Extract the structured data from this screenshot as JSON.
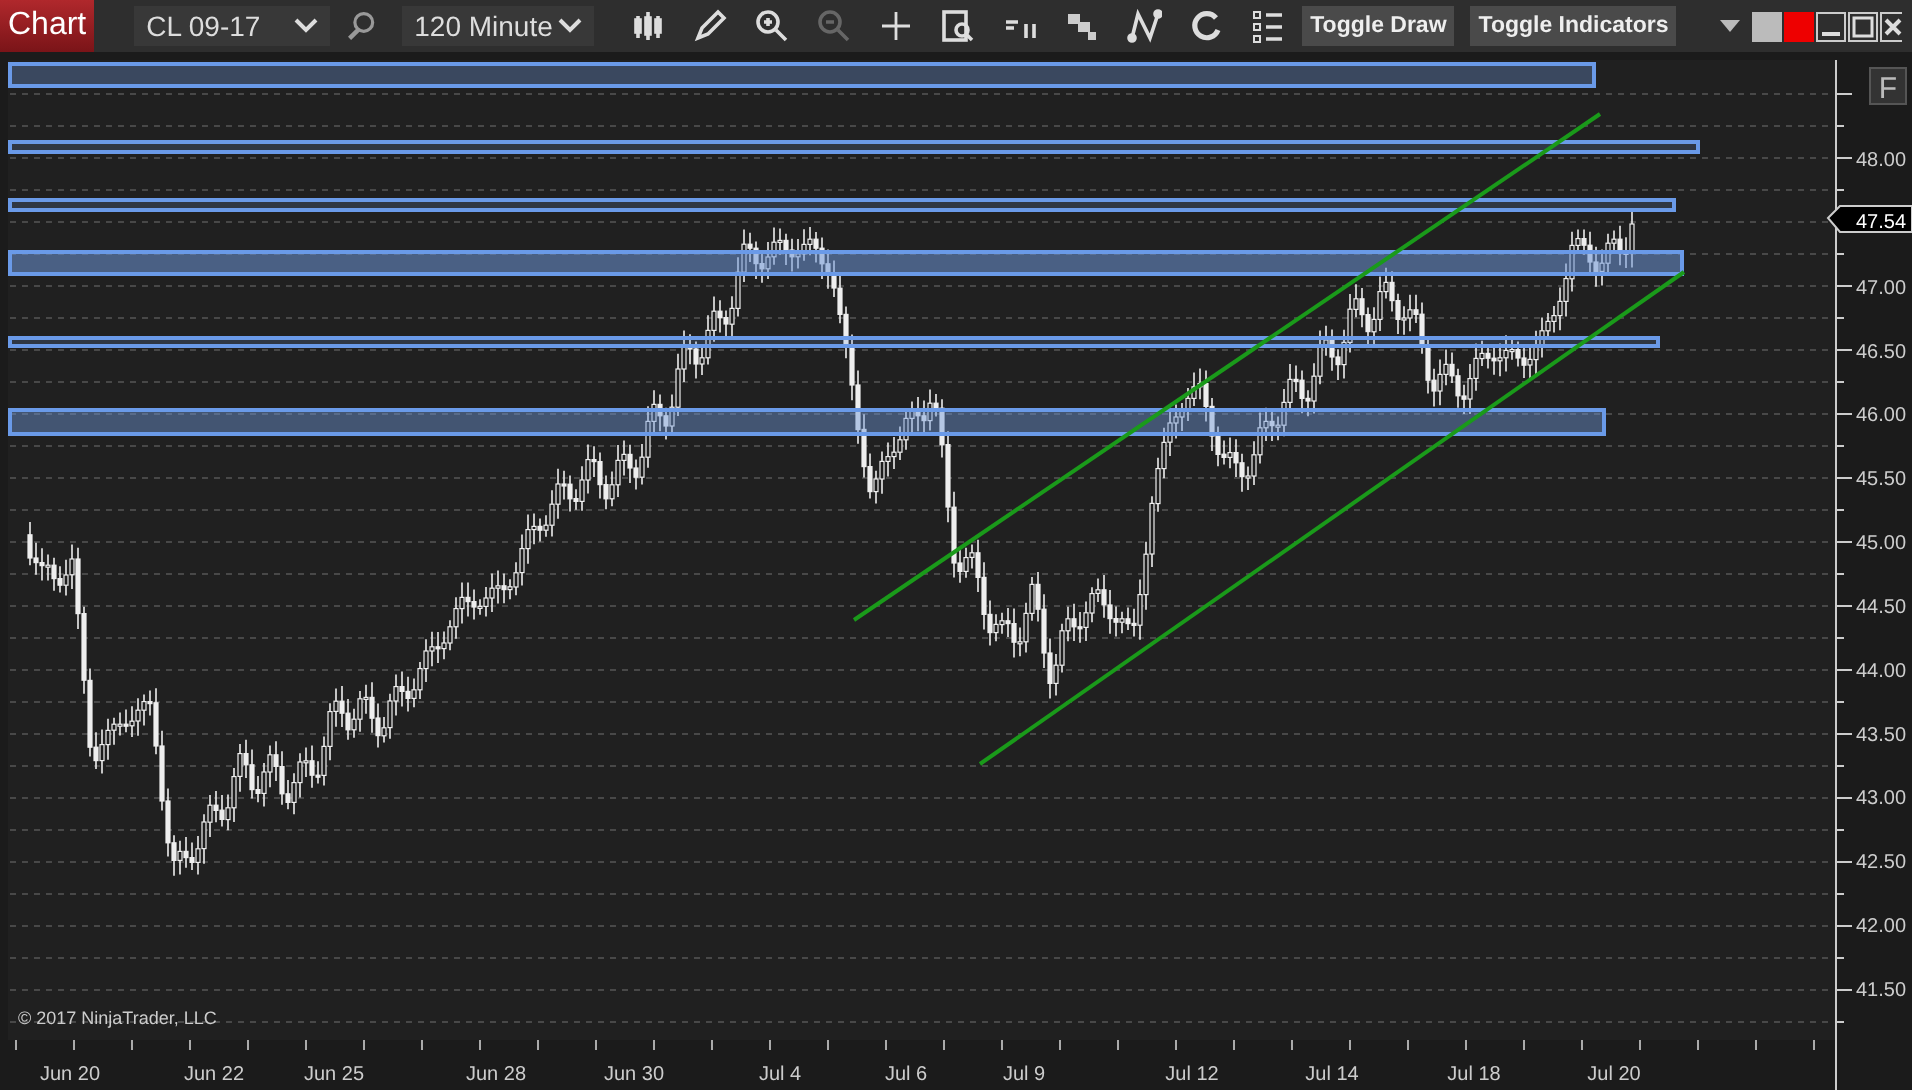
{
  "toolbar": {
    "title": "Chart",
    "instrument": "CL 09-17",
    "interval": "120 Minute",
    "buttons": [
      "Toggle Draw",
      "Toggle Indicators"
    ]
  },
  "chart": {
    "corner_button": "F",
    "price_marker": "47.54",
    "copyright": "© 2017 NinjaTrader, LLC",
    "price_labels": [
      "48.00",
      "47.00",
      "46.50",
      "46.00",
      "45.50",
      "45.00",
      "44.50",
      "44.00",
      "43.50",
      "43.00",
      "42.50",
      "42.00",
      "41.50"
    ],
    "date_labels": [
      "Jun 20",
      "Jun 22",
      "Jun 25",
      "Jun 28",
      "Jun 30",
      "Jul 4",
      "Jul 6",
      "Jul 9",
      "Jul 12",
      "Jul 14",
      "Jul 18",
      "Jul 20"
    ]
  }
}
